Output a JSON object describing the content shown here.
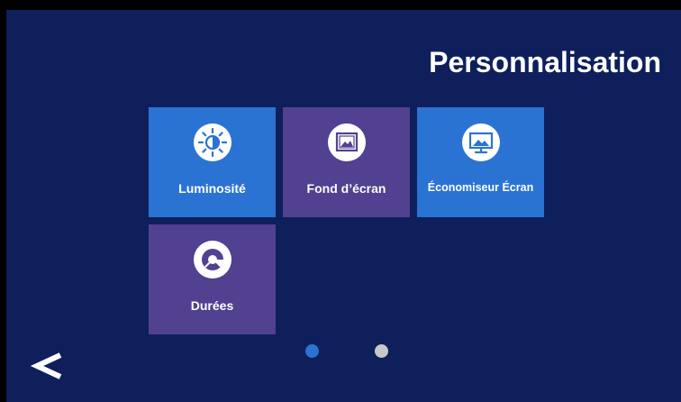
{
  "page": {
    "title": "Personnalisation"
  },
  "tiles": [
    {
      "label": "Luminosité",
      "icon": "brightness-icon",
      "color": "#2a73d3"
    },
    {
      "label": "Fond d’écran",
      "icon": "image-icon",
      "color": "#524090"
    },
    {
      "label": "Économiseur Écran",
      "icon": "screensaver-icon",
      "color": "#2a73d3"
    },
    {
      "label": "Durées",
      "icon": "timer-icon",
      "color": "#524090"
    }
  ],
  "pagination": {
    "current_page": 1,
    "total_pages": 2,
    "active_color": "#2a73d3",
    "inactive_color": "#c8c8c8"
  },
  "navigation": {
    "back_icon": "chevron-left-icon"
  },
  "colors": {
    "background": "#0e1f5b",
    "frame": "#000000",
    "text": "#ffffff"
  }
}
